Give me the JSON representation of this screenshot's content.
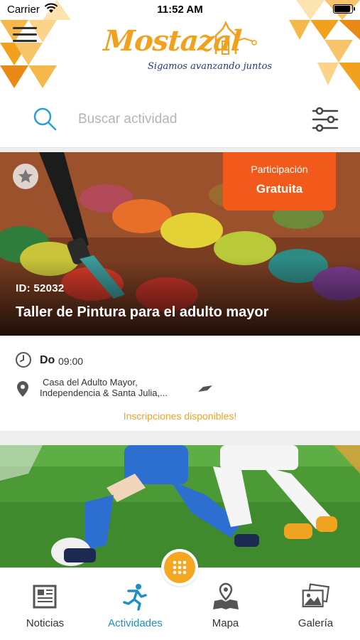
{
  "status_bar": {
    "carrier": "Carrier",
    "time": "11:52 AM",
    "icons": [
      "wifi-icon",
      "battery-icon"
    ]
  },
  "header": {
    "logo_text": "Mostazal",
    "logo_tagline": "Sigamos avanzando juntos",
    "menu_icon": "hamburger-menu-icon",
    "accent_colors": [
      "#f2a11f",
      "#f7c46a",
      "#e98a16",
      "#233a7a"
    ]
  },
  "search": {
    "placeholder": "Buscar actividad",
    "value": "",
    "search_icon": "search-icon",
    "filter_icon": "sliders-filter-icon",
    "icon_color": "#2a9fd6"
  },
  "activity_card": {
    "image": "paint-palette-with-brush",
    "favorite_icon": "star-icon",
    "badge_label": "Participación",
    "badge_value": "Gratuita",
    "badge_color": "#f25a1b",
    "id_text": "ID: 52032",
    "title": "Taller de Pintura para el adulto mayor",
    "day": "Do",
    "time": "09:00",
    "address_line1": "Casa del  Adulto Mayor,",
    "address_line2": "Independencia & Santa Julia,...",
    "map_icon": "map-marker-icon",
    "status": "Inscripciones disponibles!",
    "status_color": "#f0a326"
  },
  "second_card": {
    "image": "soccer-players-on-field"
  },
  "bottom_nav": {
    "center_button_icon": "grid-icon",
    "center_button_color": "#f5a623",
    "active_color": "#1b8fc6",
    "tabs": [
      {
        "label": "Noticias",
        "icon": "newspaper-icon",
        "active": false
      },
      {
        "label": "Actividades",
        "icon": "running-person-icon",
        "active": true
      },
      {
        "label": "Mapa",
        "icon": "map-pin-icon",
        "active": false
      },
      {
        "label": "Galería",
        "icon": "photo-gallery-icon",
        "active": false
      }
    ]
  }
}
